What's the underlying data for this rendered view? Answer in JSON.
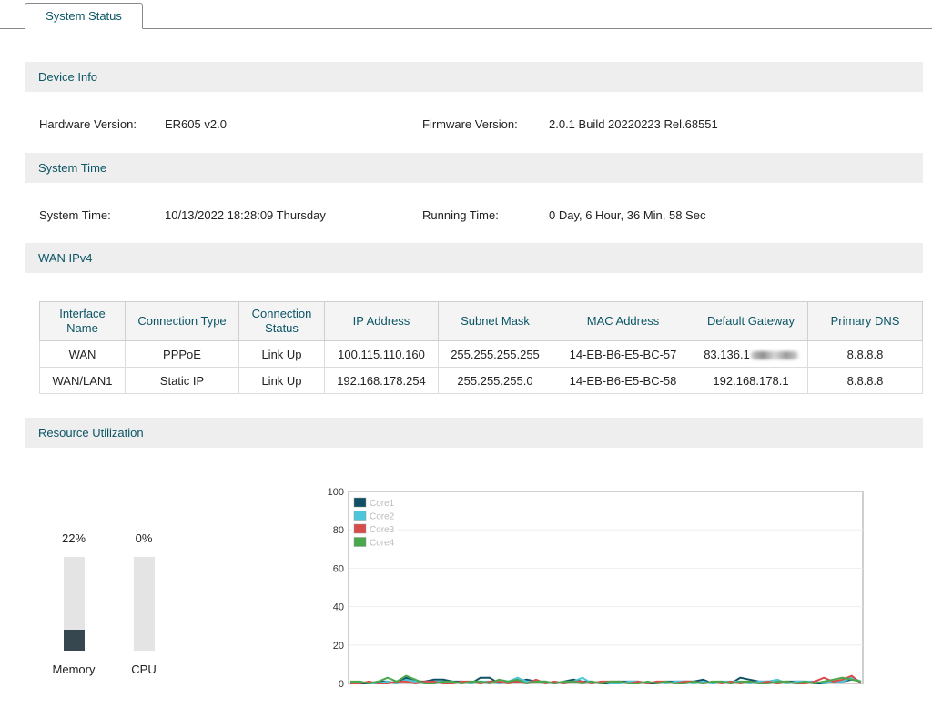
{
  "tab": {
    "label": "System Status"
  },
  "device_info": {
    "title": "Device Info",
    "hardware_label": "Hardware Version:",
    "hardware_value": "ER605 v2.0",
    "firmware_label": "Firmware Version:",
    "firmware_value": "2.0.1 Build 20220223 Rel.68551"
  },
  "system_time": {
    "title": "System Time",
    "time_label": "System Time:",
    "time_value": "10/13/2022 18:28:09 Thursday",
    "running_label": "Running Time:",
    "running_value": "0 Day, 6 Hour, 36 Min, 58 Sec"
  },
  "wan": {
    "title": "WAN IPv4",
    "headers": [
      "Interface Name",
      "Connection Type",
      "Connection Status",
      "IP Address",
      "Subnet Mask",
      "MAC Address",
      "Default Gateway",
      "Primary DNS"
    ],
    "rows": [
      [
        "WAN",
        "PPPoE",
        "Link Up",
        "100.115.110.160",
        "255.255.255.255",
        "14-EB-B6-E5-BC-57",
        "83.136.1",
        "8.8.8.8"
      ],
      [
        "WAN/LAN1",
        "Static IP",
        "Link Up",
        "192.168.178.254",
        "255.255.255.0",
        "14-EB-B6-E5-BC-58",
        "192.168.178.1",
        "8.8.8.8"
      ]
    ]
  },
  "resources": {
    "title": "Resource Utilization",
    "memory": {
      "label": "Memory",
      "value_text": "22%",
      "percent": 22
    },
    "cpu": {
      "label": "CPU",
      "value_text": "0%",
      "percent": 0
    }
  },
  "chart_data": {
    "type": "line",
    "title": "",
    "xlabel": "",
    "ylabel": "",
    "ylim": [
      0,
      100
    ],
    "yticks": [
      0,
      20,
      40,
      60,
      80,
      100
    ],
    "grid": true,
    "legend": "top-left",
    "series": [
      {
        "name": "Core1",
        "color": "#0f5066",
        "values": [
          1,
          0,
          0,
          1,
          1,
          0,
          3,
          1,
          1,
          2,
          2,
          1,
          1,
          0,
          3,
          3,
          0,
          1,
          1,
          2,
          1,
          1,
          0,
          1,
          2,
          1,
          1,
          0,
          0,
          1,
          1,
          1,
          0,
          0,
          1,
          1,
          1,
          1,
          2,
          0,
          1,
          0,
          3,
          2,
          1,
          1,
          0,
          1,
          1,
          1,
          0,
          0,
          1,
          1,
          2,
          1
        ]
      },
      {
        "name": "Core2",
        "color": "#4cc6d8",
        "values": [
          0,
          1,
          0,
          0,
          1,
          0,
          2,
          1,
          0,
          1,
          1,
          0,
          1,
          0,
          1,
          1,
          0,
          1,
          3,
          1,
          1,
          0,
          1,
          0,
          1,
          3,
          0,
          1,
          0,
          0,
          1,
          1,
          0,
          1,
          0,
          1,
          1,
          0,
          1,
          0,
          1,
          1,
          1,
          0,
          1,
          1,
          2,
          0,
          1,
          1,
          1,
          0,
          1,
          1,
          3,
          1
        ]
      },
      {
        "name": "Core3",
        "color": "#d94c4c",
        "values": [
          0,
          0,
          1,
          0,
          0,
          1,
          1,
          0,
          1,
          1,
          0,
          0,
          1,
          1,
          0,
          1,
          1,
          0,
          1,
          0,
          2,
          0,
          1,
          0,
          1,
          1,
          0,
          1,
          1,
          1,
          0,
          1,
          0,
          1,
          1,
          0,
          1,
          1,
          0,
          1,
          0,
          1,
          0,
          1,
          0,
          1,
          0,
          1,
          0,
          0,
          1,
          3,
          1,
          2,
          4,
          0
        ]
      },
      {
        "name": "Core4",
        "color": "#49a84a",
        "values": [
          1,
          1,
          0,
          1,
          3,
          1,
          4,
          2,
          0,
          0,
          1,
          1,
          0,
          1,
          1,
          0,
          2,
          1,
          2,
          0,
          1,
          1,
          0,
          1,
          1,
          0,
          1,
          0,
          1,
          1,
          0,
          0,
          1,
          0,
          1,
          0,
          0,
          1,
          0,
          1,
          1,
          0,
          1,
          1,
          0,
          0,
          1,
          1,
          0,
          1,
          0,
          1,
          2,
          3,
          2,
          1
        ]
      }
    ]
  }
}
